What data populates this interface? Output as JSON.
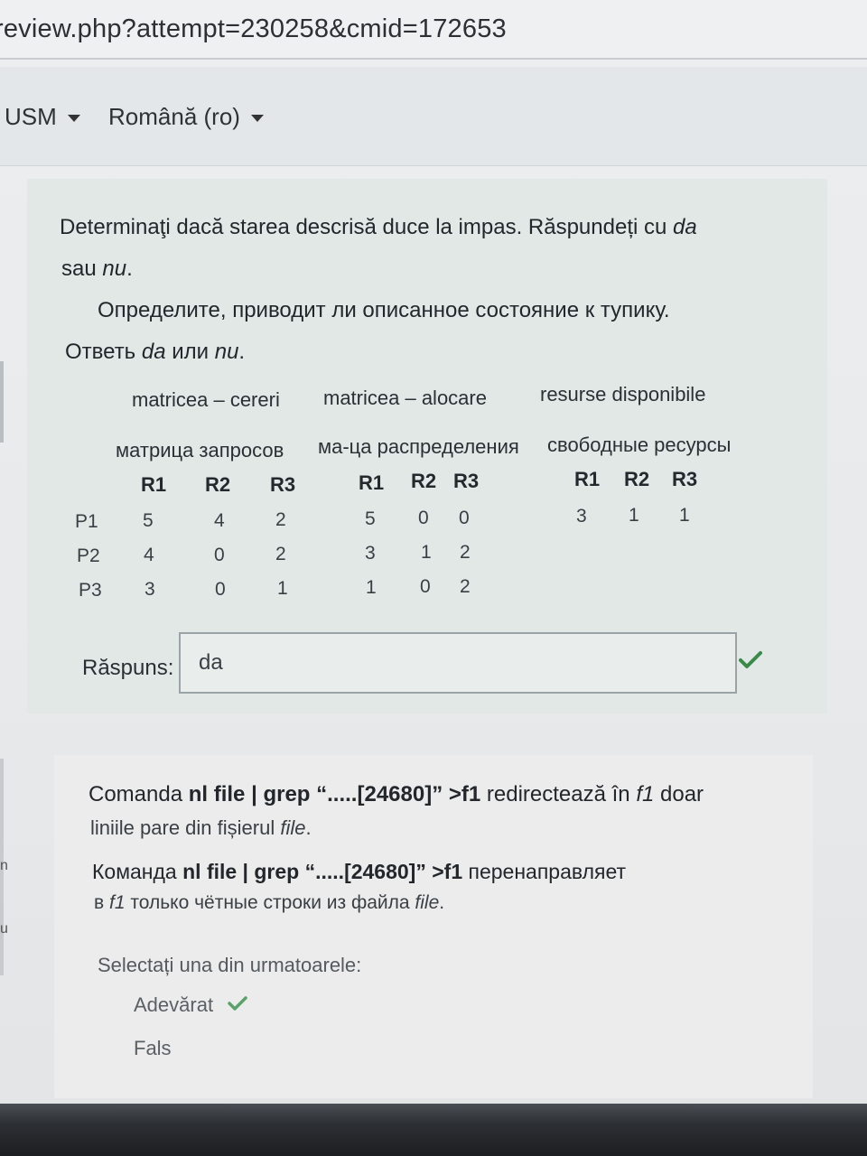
{
  "browser": {
    "url": "review.php?attempt=230258&cmid=172653"
  },
  "nav": {
    "items": [
      {
        "label": "USM"
      },
      {
        "label": "Română (ro)"
      }
    ]
  },
  "question1": {
    "text_ro_line1_a": "Determinaţi dacă starea descrisă duce la impas. Răspundeți cu ",
    "text_ro_line1_b": "da",
    "text_ro_line2_a": "sau ",
    "text_ro_line2_b": "nu",
    "text_ro_line2_c": ".",
    "text_ru_line1": "Определите, приводит ли описанное состояние к тупику.",
    "text_ru_line2_a": "Ответь ",
    "text_ru_line2_b": "da",
    "text_ru_line2_c": " или ",
    "text_ru_line2_d": "nu",
    "text_ru_line2_e": ".",
    "matrices": {
      "requests_ro": "matricea – cereri",
      "allocation_ro": "matricea – alocare",
      "available_ro": "resurse disponibile",
      "requests_ru": "матрица запросов",
      "allocation_ru": "ма-ца распределения",
      "available_ru": "свободные ресурсы"
    },
    "columns": [
      "R1",
      "R2",
      "R3"
    ],
    "rows": [
      "P1",
      "P2",
      "P3"
    ],
    "requests": [
      [
        "5",
        "4",
        "2"
      ],
      [
        "4",
        "0",
        "2"
      ],
      [
        "3",
        "0",
        "1"
      ]
    ],
    "allocation": [
      [
        "5",
        "0",
        "0"
      ],
      [
        "3",
        "1",
        "2"
      ],
      [
        "1",
        "0",
        "2"
      ]
    ],
    "available": [
      "3",
      "1",
      "1"
    ],
    "answer_label": "Răspuns:",
    "answer_value": "da",
    "status_color": "#3a8a4a"
  },
  "question2": {
    "ro_a": "Comanda ",
    "ro_b": "nl file | grep “.....[24680]” >f1",
    "ro_c": "  redirectează în ",
    "ro_d": "f1",
    "ro_e": " doar",
    "ro_line2_a": "liniile pare din fișierul ",
    "ro_line2_b": "file",
    "ro_line2_c": ".",
    "ru_a": "Команда ",
    "ru_b": "nl file | grep “.....[24680]” >f1",
    "ru_c": " перенаправляет",
    "ru_line2_a": "в ",
    "ru_line2_b": "f1",
    "ru_line2_c": " только чётные строки из файла ",
    "ru_line2_d": "file",
    "ru_line2_e": ".",
    "prompt": "Selectați una din urmatoarele:",
    "options": [
      {
        "label": "Adevărat",
        "correct": true
      },
      {
        "label": "Fals",
        "correct": false
      }
    ]
  },
  "left_edge": {
    "frag1": "n",
    "frag2": "u"
  }
}
